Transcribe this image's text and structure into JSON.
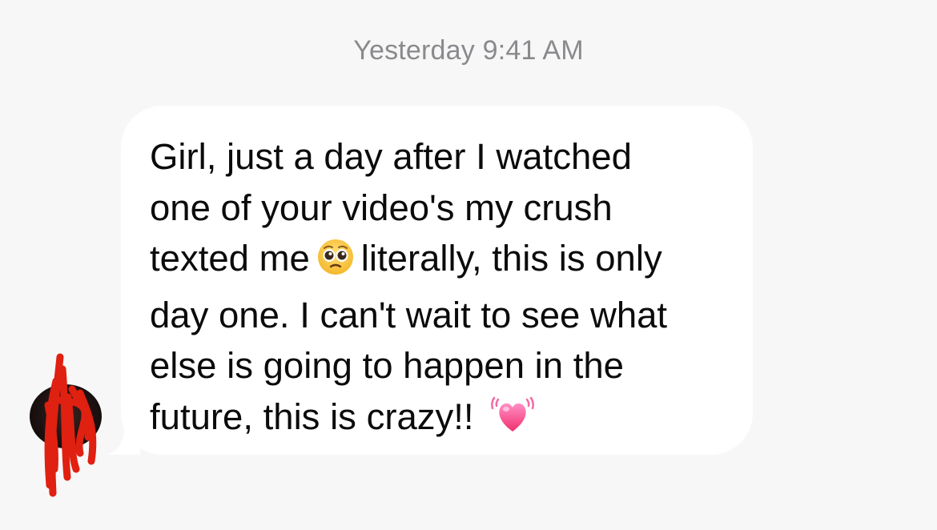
{
  "conversation": {
    "timestamp": "Yesterday 9:41 AM",
    "message": {
      "lines": [
        "Girl, just a day after I watched",
        "one of your video's my crush",
        "texted me",
        "literally, this is only",
        "day one. I can't wait to see what",
        "else is going to happen in the",
        "future, this is crazy!!"
      ],
      "emojis": [
        "pleading-face-emoji",
        "beating-heart-emoji"
      ]
    },
    "sender_avatar": {
      "icon": "avatar",
      "obscured": true,
      "obscure_color": "#e02010"
    }
  },
  "colors": {
    "background": "#f7f7f7",
    "bubble": "#ffffff",
    "text": "#0b0b0b",
    "timestamp": "#8a8a8e"
  }
}
